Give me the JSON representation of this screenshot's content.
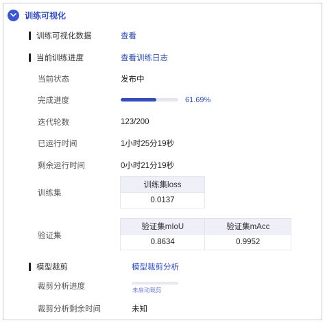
{
  "section": {
    "title": "训练可视化"
  },
  "viz_data": {
    "label": "训练可视化数据",
    "action": "查看"
  },
  "train_progress": {
    "label": "当前训练进度",
    "action": "查看训练日志"
  },
  "status": {
    "label": "当前状态",
    "value": "发布中"
  },
  "completion": {
    "label": "完成进度",
    "percent_text": "61.69%",
    "fraction": 0.6169
  },
  "iterations": {
    "label": "迭代轮数",
    "value": "123/200"
  },
  "elapsed": {
    "label": "已运行时间",
    "value": "1小时25分19秒"
  },
  "remaining": {
    "label": "剩余运行时间",
    "value": "0小时21分19秒"
  },
  "train_set": {
    "label": "训练集",
    "headers": [
      "训练集loss"
    ],
    "values": [
      "0.0137"
    ]
  },
  "val_set": {
    "label": "验证集",
    "headers": [
      "验证集mIoU",
      "验证集mAcc"
    ],
    "values": [
      "0.8634",
      "0.9952"
    ]
  },
  "pruning": {
    "label": "模型裁剪",
    "action": "模型裁剪分析"
  },
  "prune_progress": {
    "label": "裁剪分析进度",
    "status_text": "未启动裁剪",
    "fraction": 0
  },
  "prune_remaining": {
    "label": "裁剪分析剩余时间",
    "value": "未知"
  },
  "colors": {
    "accent": "#2f4bd0",
    "header_bg": "#efeffa"
  },
  "icons": {
    "section_toggle": "chevron-down-icon"
  }
}
